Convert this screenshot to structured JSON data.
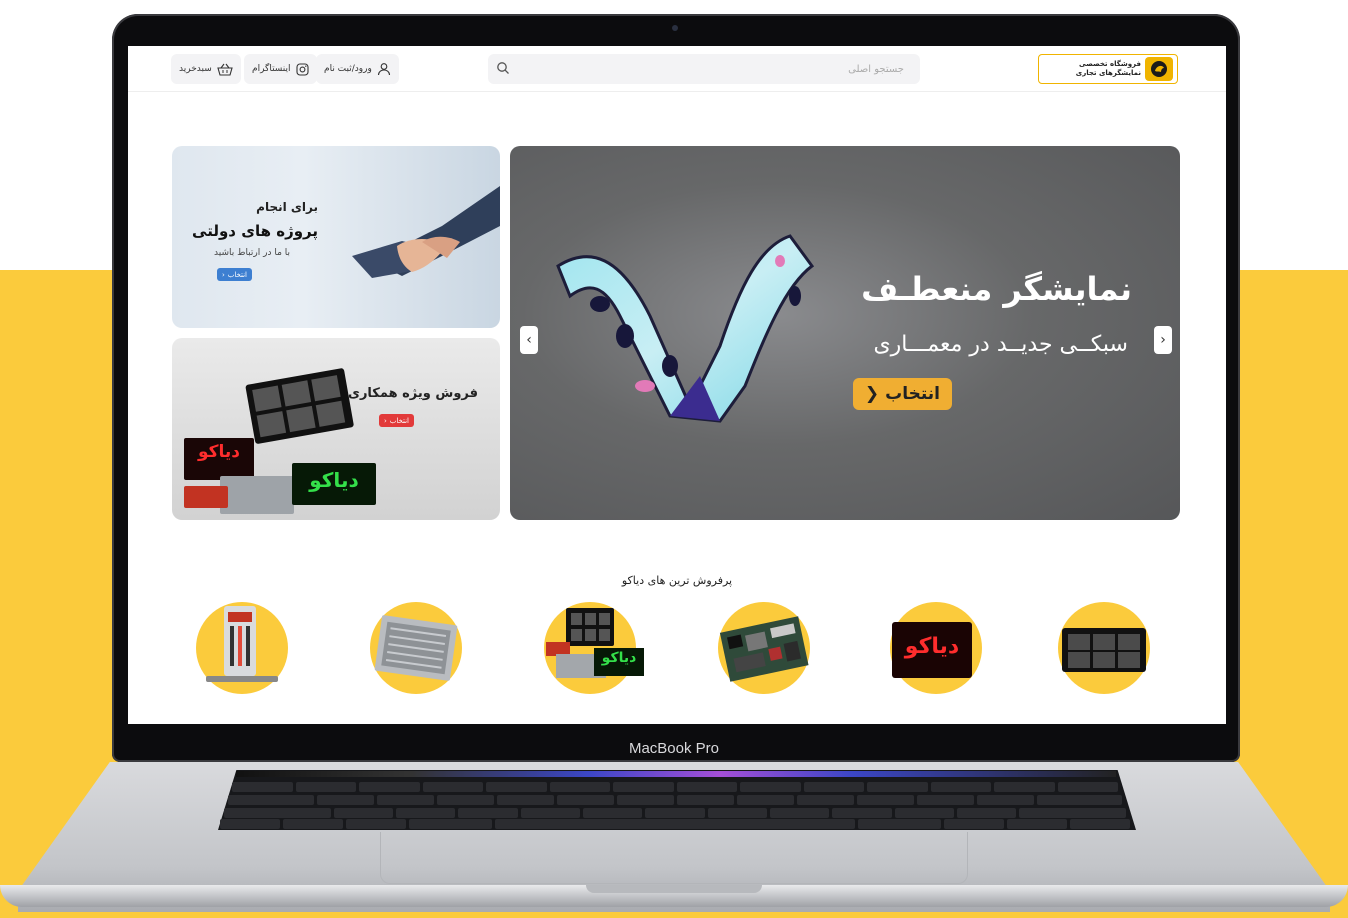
{
  "device": {
    "model_label": "MacBook Pro"
  },
  "colors": {
    "accent": "#fbcb3c",
    "button": "#f0ae32",
    "blue_btn": "#3d7fd1",
    "red_btn": "#e23a3a"
  },
  "header": {
    "logo": {
      "line1": "فروشگاه تخصصی",
      "line2": "نمایشگرهای تجاری",
      "icon": "lion-logo-icon"
    },
    "search": {
      "placeholder": "جستجو اصلی",
      "icon": "search-icon"
    },
    "login": {
      "label": "ورود/ثبت نام",
      "icon": "user-icon"
    },
    "instagram": {
      "label": "اینستاگرام",
      "icon": "instagram-icon"
    },
    "cart": {
      "label": "سبدخرید",
      "icon": "basket-icon"
    }
  },
  "hero": {
    "title": "نمایشگر منعطـف",
    "subtitle": "سبکــی جدیــد در معمـــاری",
    "button": "انتخاب",
    "prev_icon": "chevron-left-icon",
    "next_icon": "chevron-right-icon"
  },
  "cards": [
    {
      "line1": "برای انجام",
      "line2": "پروژه های دولتی",
      "line3": "با ما در ارتباط باشید",
      "button": "انتخاب"
    },
    {
      "title": "فروش ویژه همکاری",
      "button": "انتخاب",
      "sign_text": "دیاکو"
    }
  ],
  "bestsellers": {
    "title": "پرفروش ترین های دیاکو",
    "items": [
      {
        "icon": "led-frame-icon"
      },
      {
        "icon": "red-led-board-icon",
        "text": "دیاکو"
      },
      {
        "icon": "controller-board-icon"
      },
      {
        "icon": "led-kit-icon",
        "text": "دیاکو"
      },
      {
        "icon": "power-supply-icon"
      },
      {
        "icon": "tool-kit-icon"
      }
    ]
  }
}
